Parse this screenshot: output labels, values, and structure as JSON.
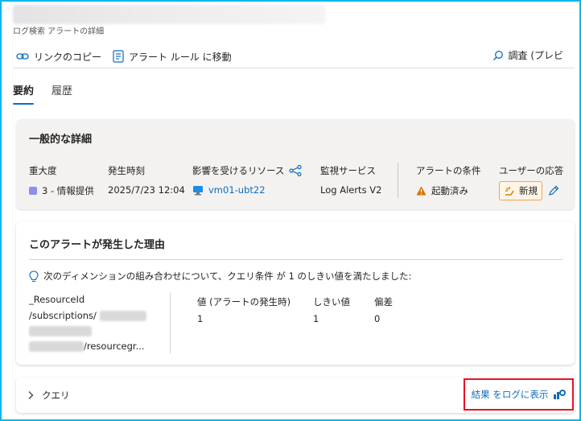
{
  "header": {
    "subtitle": "ログ検索 アラートの詳細"
  },
  "commandbar": {
    "copy_link": "リンクのコピー",
    "goto_rule": "アラート ルール に移動",
    "investigate": "調査 (プレビ"
  },
  "tabs": [
    {
      "label": "要約",
      "active": true
    },
    {
      "label": "履歴",
      "active": false
    }
  ],
  "general": {
    "title": "一般的な詳細",
    "severity_label": "重大度",
    "severity_value": "3 - 情報提供",
    "fired_label": "発生時刻",
    "fired_value": "2025/7/23 12:04",
    "resource_label": "影響を受けるリソース",
    "resource_value": "vm01-ubt22",
    "monitor_label": "監視サービス",
    "monitor_value": "Log Alerts V2",
    "condition_label": "アラートの条件",
    "condition_value": "起動済み",
    "user_response_label": "ユーザーの応答",
    "user_response_value": "新規"
  },
  "why": {
    "title": "このアラートが発生した理由",
    "note": "次のディメンションの組み合わせについて、クエリ条件 が 1 のしきい値を満たしました:",
    "resource_header": "_ResourceId",
    "resource_line1": "/subscriptions/",
    "resource_line3": "/resourcegr...",
    "columns": [
      "値 (アラートの発生時)",
      "しきい値",
      "偏差"
    ],
    "row": [
      "1",
      "1",
      "0"
    ]
  },
  "query": {
    "label": "クエリ",
    "results_link": "結果 をログに表示"
  },
  "colors": {
    "accent": "#0f6cbd",
    "severity": "#8c8ef0",
    "warning": "#d47500",
    "highlight_border": "#e81123",
    "frame": "#00b7eb"
  }
}
